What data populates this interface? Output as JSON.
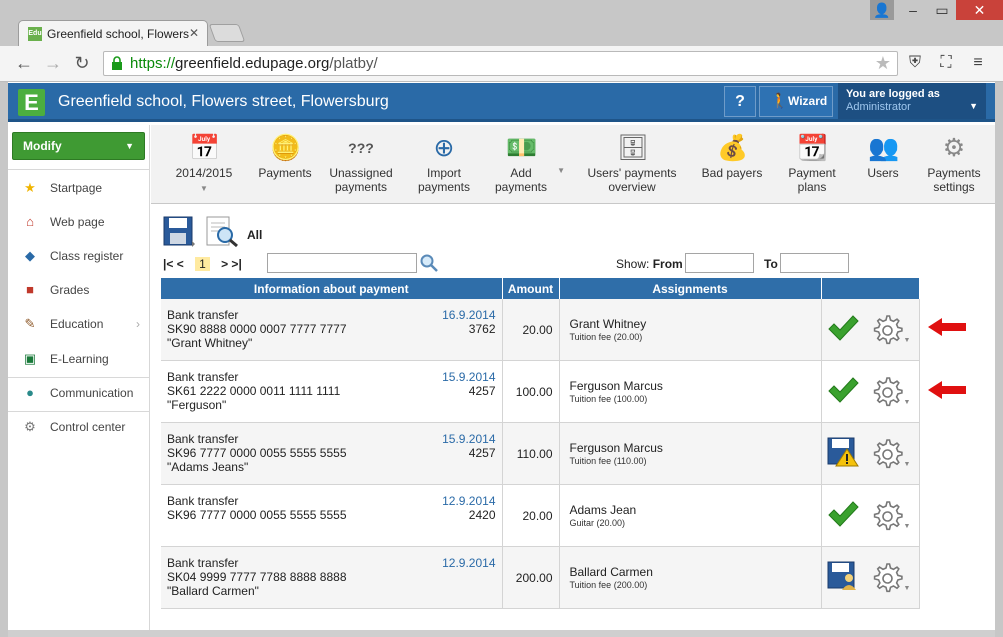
{
  "browser": {
    "tab_title": "Greenfield school, Flowers",
    "tab_favicon_text": "Edu",
    "url_scheme": "https://",
    "url_host": "greenfield.edupage.org",
    "url_path": "/platby/"
  },
  "header": {
    "logo_letter": "E",
    "school_name": "Greenfield school, Flowers street, Flowersburg",
    "help_label": "?",
    "wizard_label": "Wizard",
    "logged_as_label": "You are logged as",
    "user_name": "Administrator"
  },
  "sidebar": {
    "modify_label": "Modify",
    "items": [
      {
        "label": "Startpage",
        "icon": "star-icon"
      },
      {
        "label": "Web page",
        "icon": "home-icon"
      },
      {
        "label": "Class register",
        "icon": "book-icon"
      },
      {
        "label": "Grades",
        "icon": "grades-icon"
      },
      {
        "label": "Education",
        "icon": "education-icon"
      },
      {
        "label": "E-Learning",
        "icon": "elearning-icon"
      },
      {
        "label": "Communication",
        "icon": "communication-icon"
      },
      {
        "label": "Control center",
        "icon": "gear-icon"
      }
    ]
  },
  "ribbon": {
    "items": [
      {
        "l1": "2014/2015",
        "l2": "",
        "icon": "calendar-icon"
      },
      {
        "l1": "Payments",
        "l2": "",
        "icon": "coins-icon"
      },
      {
        "l1": "Unassigned",
        "l2": "payments",
        "icon": "question-coins-icon"
      },
      {
        "l1": "Import",
        "l2": "payments",
        "icon": "import-icon"
      },
      {
        "l1": "Add",
        "l2": "payments",
        "icon": "add-money-icon"
      },
      {
        "l1": "Users' payments",
        "l2": "overview",
        "icon": "overview-icon"
      },
      {
        "l1": "Bad payers",
        "l2": "",
        "icon": "bad-payers-icon"
      },
      {
        "l1": "Payment",
        "l2": "plans",
        "icon": "plans-icon"
      },
      {
        "l1": "Users",
        "l2": "",
        "icon": "users-icon"
      },
      {
        "l1": "Payments",
        "l2": "settings",
        "icon": "gear-icon"
      }
    ]
  },
  "filters": {
    "all_label": "All",
    "pager_first": "|< <",
    "pager_current": "1",
    "pager_last": "> >|",
    "show_label": "Show:",
    "from_label": "From",
    "to_label": "To"
  },
  "table": {
    "headers": [
      "Information about payment",
      "Amount",
      "Assignments",
      ""
    ],
    "rows": [
      {
        "type": "Bank transfer",
        "account": "SK90 8888 0000 0007 7777 7777",
        "payer": "\"Grant Whitney\"",
        "date": "16.9.2014",
        "ref": "3762",
        "amount": "20.00",
        "name": "Grant Whitney",
        "fee": "Tuition fee (20.00)",
        "status": "check"
      },
      {
        "type": "Bank transfer",
        "account": "SK61 2222 0000 0011 1111 1111",
        "payer": "\"Ferguson\"",
        "date": "15.9.2014",
        "ref": "4257",
        "amount": "100.00",
        "name": "Ferguson Marcus",
        "fee": "Tuition fee (100.00)",
        "status": "check"
      },
      {
        "type": "Bank transfer",
        "account": "SK96 7777 0000 0055 5555 5555",
        "payer": "\"Adams Jeans\"",
        "date": "15.9.2014",
        "ref": "4257",
        "amount": "110.00",
        "name": "Ferguson Marcus",
        "fee": "Tuition fee (110.00)",
        "status": "warning"
      },
      {
        "type": "Bank transfer",
        "account": "SK96 7777 0000 0055 5555 5555",
        "payer": "",
        "date": "12.9.2014",
        "ref": "2420",
        "amount": "20.00",
        "name": "Adams Jean",
        "fee": "Guitar (20.00)",
        "status": "check"
      },
      {
        "type": "Bank transfer",
        "account": "SK04 9999 7777 7788 8888 8888",
        "payer": "\"Ballard Carmen\"",
        "date": "12.9.2014",
        "ref": "",
        "amount": "200.00",
        "name": "Ballard Carmen",
        "fee": "Tuition fee (200.00)",
        "status": "save-person"
      }
    ]
  },
  "colors": {
    "header_blue": "#2a6aa7",
    "green": "#3f9a33",
    "check_green": "#3aa12e",
    "arrow_red": "#e01010"
  }
}
